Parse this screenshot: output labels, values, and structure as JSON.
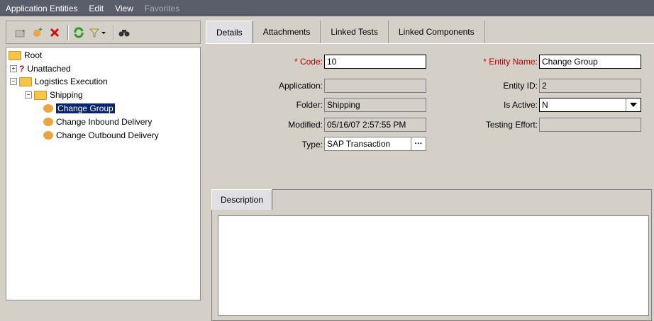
{
  "menu": [
    "Application Entities",
    "Edit",
    "View",
    "Favorites"
  ],
  "toolbar": {
    "icons": [
      "new-folder-icon",
      "new-entity-icon",
      "delete-icon",
      "refresh-icon",
      "filter-icon",
      "find-icon"
    ]
  },
  "tree": {
    "root": "Root",
    "unattached": "Unattached",
    "logistics": "Logistics Execution",
    "shipping": "Shipping",
    "items": [
      "Change Group",
      "Change Inbound Delivery",
      "Change Outbound Delivery"
    ]
  },
  "tabs": [
    "Details",
    "Attachments",
    "Linked Tests",
    "Linked Components"
  ],
  "form": {
    "code_label": "Code:",
    "code_value": "10",
    "application_label": "Application:",
    "application_value": "",
    "folder_label": "Folder:",
    "folder_value": "Shipping",
    "modified_label": "Modified:",
    "modified_value": "05/16/07 2:57:55 PM",
    "type_label": "Type:",
    "type_value": "SAP Transaction",
    "entity_name_label": "Entity Name:",
    "entity_name_value": "Change Group",
    "entity_id_label": "Entity ID:",
    "entity_id_value": "2",
    "is_active_label": "Is Active:",
    "is_active_value": "N",
    "testing_effort_label": "Testing Effort:",
    "testing_effort_value": ""
  },
  "description_tab": "Description",
  "colors": {
    "menubar": "#5a5e6a",
    "required": "#c00000",
    "selection": "#0a246a"
  }
}
